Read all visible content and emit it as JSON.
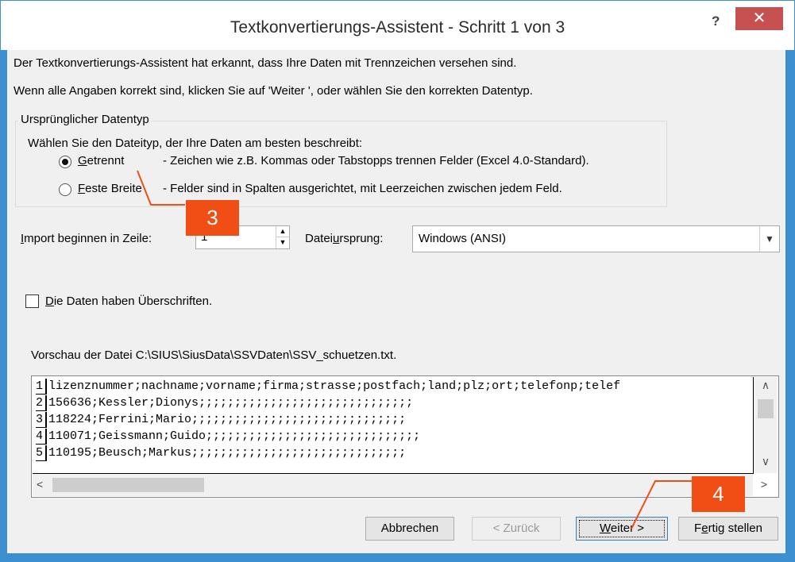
{
  "window": {
    "title": "Textkonvertierungs-Assistent - Schritt 1 von 3",
    "help_label": "?",
    "close_label": "✕"
  },
  "intro": {
    "line1": "Der Textkonvertierungs-Assistent hat erkannt, dass Ihre Daten mit Trennzeichen versehen sind.",
    "line2": "Wenn alle Angaben korrekt sind, klicken Sie auf 'Weiter ', oder wählen Sie den korrekten Datentyp."
  },
  "datatype_group": {
    "label": "Ursprünglicher Datentyp",
    "prompt": "Wählen Sie den Dateityp, der Ihre Daten am besten beschreibt:",
    "options": [
      {
        "mnemonic": "G",
        "rest": "etrennt",
        "description": "- Zeichen wie z.B. Kommas oder Tabstopps trennen Felder (Excel 4.0-Standard).",
        "selected": true
      },
      {
        "mnemonic": "F",
        "rest": "este Breite",
        "description": "- Felder sind in Spalten ausgerichtet, mit Leerzeichen zwischen jedem Feld.",
        "selected": false
      }
    ]
  },
  "import_start": {
    "label_mnemonic": "I",
    "label_rest": "mport beginnen in Zeile:",
    "value": "1"
  },
  "file_origin": {
    "label_pre": "Datei",
    "label_mnemonic": "u",
    "label_post": "rsprung:",
    "value": "Windows (ANSI)"
  },
  "headers_checkbox": {
    "mnemonic": "D",
    "rest": "ie Daten haben Überschriften.",
    "checked": false
  },
  "preview": {
    "label": "Vorschau der Datei C:\\SIUS\\SiusData\\SSVDaten\\SSV_schuetzen.txt.",
    "rows": [
      {
        "num": "1",
        "text": "lizenznummer;nachname;vorname;firma;strasse;postfach;land;plz;ort;telefonp;telef"
      },
      {
        "num": "2",
        "text": "156636;Kessler;Dionys;;;;;;;;;;;;;;;;;;;;;;;;;;;;;;"
      },
      {
        "num": "3",
        "text": "118224;Ferrini;Mario;;;;;;;;;;;;;;;;;;;;;;;;;;;;;;"
      },
      {
        "num": "4",
        "text": "110071;Geissmann;Guido;;;;;;;;;;;;;;;;;;;;;;;;;;;;;;"
      },
      {
        "num": "5",
        "text": "110195;Beusch;Markus;;;;;;;;;;;;;;;;;;;;;;;;;;;;;;"
      }
    ]
  },
  "buttons": {
    "cancel": "Abbrechen",
    "back": "< Zurück",
    "next_mnemonic": "W",
    "next_rest": "eiter >",
    "finish_pre": "F",
    "finish_mnemonic": "e",
    "finish_rest": "rtig stellen"
  },
  "callouts": {
    "step3": "3",
    "step4": "4",
    "color": "#f04e14"
  }
}
